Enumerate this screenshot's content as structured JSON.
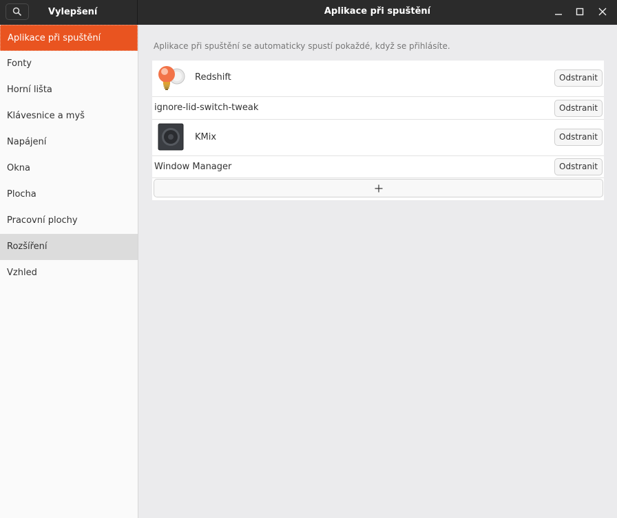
{
  "header": {
    "sidebar_title": "Vylepšení",
    "title": "Aplikace při spuštění",
    "search_icon": "search-icon",
    "window_controls": [
      "minimize-icon",
      "maximize-icon",
      "close-icon"
    ]
  },
  "sidebar": {
    "items": [
      {
        "label": "Aplikace při spuštění",
        "state": "active"
      },
      {
        "label": "Fonty"
      },
      {
        "label": "Horní lišta"
      },
      {
        "label": "Klávesnice a myš"
      },
      {
        "label": "Napájení"
      },
      {
        "label": "Okna"
      },
      {
        "label": "Plocha"
      },
      {
        "label": "Pracovní plochy"
      },
      {
        "label": "Rozšíření",
        "state": "hover"
      },
      {
        "label": "Vzhled"
      }
    ]
  },
  "main": {
    "description": "Aplikace při spuštění se automaticky spustí pokaždé, když se přihlásíte.",
    "apps": [
      {
        "name": "Redshift",
        "icon": "redshift-bulb-icon",
        "remove_label": "Odstranit"
      },
      {
        "name": "ignore-lid-switch-tweak",
        "icon": null,
        "remove_label": "Odstranit"
      },
      {
        "name": "KMix",
        "icon": "kmix-speaker-icon",
        "remove_label": "Odstranit"
      },
      {
        "name": "Window Manager",
        "icon": null,
        "remove_label": "Odstranit"
      }
    ],
    "add_icon": "plus-icon"
  },
  "colors": {
    "accent": "#e95420",
    "headerbar": "#2b2b2b",
    "sidebar_bg": "#fafafa",
    "content_bg": "#ebebed"
  }
}
